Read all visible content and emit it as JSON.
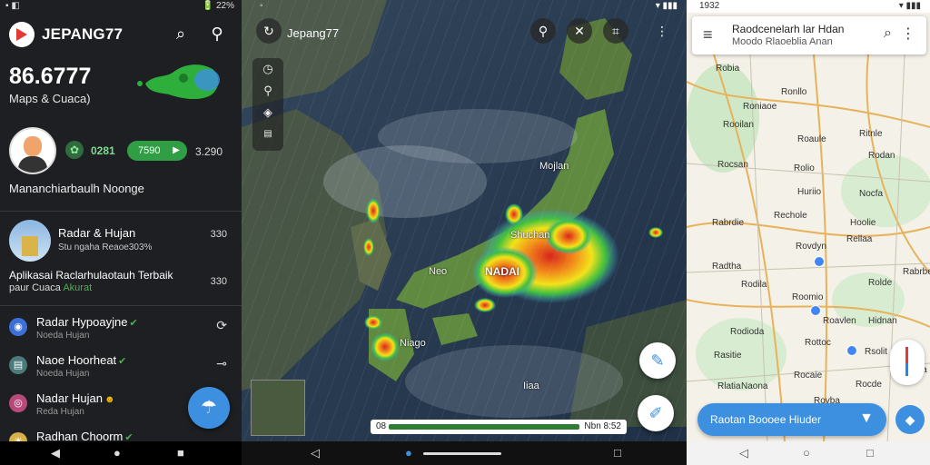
{
  "left": {
    "status": {
      "time": "",
      "right": "🔋 22%"
    },
    "app_name": "JEPANG77",
    "big_number": "86.6777",
    "subtitle": "Maps & Cuaca)",
    "counter1": "0281",
    "pill_value": "7590",
    "counter2": "3.290",
    "tagline": "Mananchiarbaulh  Noonge",
    "card": {
      "title": "Radar & Hujan",
      "subtitle": "Stu ngaha Reaoe303%",
      "count": "330"
    },
    "description": {
      "line1": "Aplikasai Raclarhulaotauh Terbaik",
      "line2a": "paur Cuaca",
      "line2b": "Akurat",
      "count": "330"
    },
    "rows": [
      {
        "title": "Radar Hypoayjne",
        "subtitle": "Noeda Hujan",
        "icon_color": "#3d6fd8"
      },
      {
        "title": "Naoe Hoorheat",
        "subtitle": "Noeda Hujan",
        "icon_color": "#4a7a7a"
      },
      {
        "title": "Nadar Hujan",
        "subtitle": "Reda Hujan",
        "icon_color": "#b84a7a"
      },
      {
        "title": "Radhan Choorm",
        "subtitle": "",
        "icon_color": "#d8b04a"
      }
    ]
  },
  "middle": {
    "title": "Jepang77",
    "labels": {
      "north": "Mojlan",
      "central": "Shuchan",
      "capital": "NADAI",
      "west": "Neo",
      "kyushu": "Niago",
      "south": "Iiaa"
    },
    "slider_left": "08",
    "slider_right": "Nbn 8:52"
  },
  "right": {
    "status_time": "1932",
    "search_title": "Raodcenelarh lar  Hdan",
    "search_subtitle": "Moodo Rlaoeblia Anan",
    "towns": [
      "Robia",
      "Ronllo",
      "Roniaoe",
      "Rooilan",
      "Roaule",
      "Ritnle",
      "Rocsan",
      "Rolio",
      "Rodan",
      "Huriio",
      "Nocfa",
      "Rabrdie",
      "Rechole",
      "Hoolie",
      "Rovdyn",
      "Radtha",
      "Rellaa",
      "Rabrbe",
      "Rodila",
      "Roomio",
      "Roavlen",
      "Hidnan",
      "Rodioda",
      "Rottoc",
      "Rsolit",
      "Rasitie",
      "Rocaie",
      "Naona",
      "Rocde",
      "Rovba",
      "Rlatia",
      "Rolde",
      "Rotha"
    ],
    "pill_label": "Raotan Boooee Hiuder"
  }
}
